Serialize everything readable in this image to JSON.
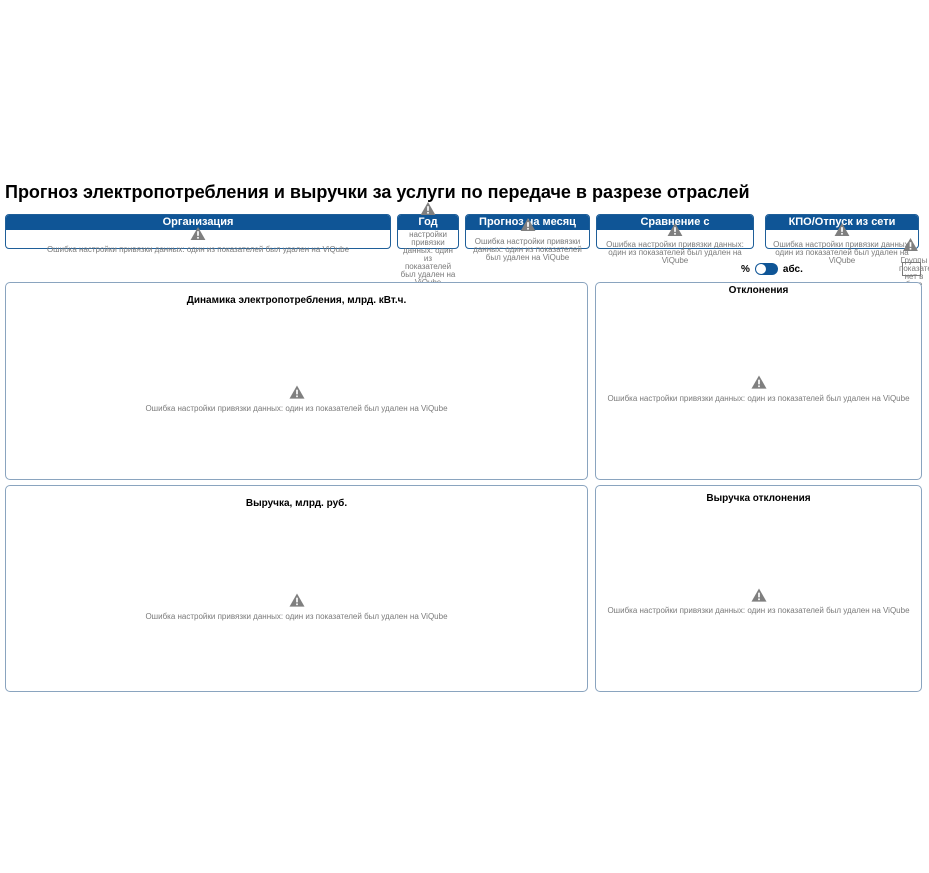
{
  "page": {
    "title": "Прогноз электропотребления и выручки за услуги по передаче в разрезе отраслей"
  },
  "filters": {
    "organization": {
      "label": "Организация",
      "error": "Ошибка настройки привязки данных: один из показателей был удален на ViQube"
    },
    "year": {
      "label": "Год",
      "error": "настройки привязки данных: один из показателей был удален на ViQube"
    },
    "forecast_month": {
      "label": "Прогноз на месяц",
      "error": "Ошибка настройки привязки данных: один из показателей был удален на ViQube"
    },
    "compare_with": {
      "label": "Сравнение с",
      "error": "Ошибка настройки привязки данных: один из показателей был удален на ViQube"
    },
    "kpo": {
      "label": "КПО/Отпуск из сети",
      "error": "Ошибка настройки привязки данных: один из показателей был удален на ViQube"
    }
  },
  "toggle": {
    "left_label": "%",
    "right_label": "абс."
  },
  "side_error": "Группы показателей нет в базе",
  "panels": {
    "consumption": {
      "title": "Динамика электропотребления, млрд. кВт.ч.",
      "error": "Ошибка настройки привязки данных: один из показателей был удален на ViQube"
    },
    "deviations": {
      "title": "Отклонения",
      "error": "Ошибка настройки привязки данных: один из показателей был удален на ViQube"
    },
    "revenue": {
      "title": "Выручка, млрд. руб.",
      "error": "Ошибка настройки привязки данных: один из показателей был удален на ViQube"
    },
    "revenue_deviations": {
      "title": "Выручка отклонения",
      "error": "Ошибка настройки привязки данных: один из показателей был удален на ViQube"
    }
  },
  "colors": {
    "accent": "#0f5596",
    "border": "#8aa4bf",
    "error_text": "#7a7a7a",
    "warning_icon": "#7f7f7f"
  }
}
